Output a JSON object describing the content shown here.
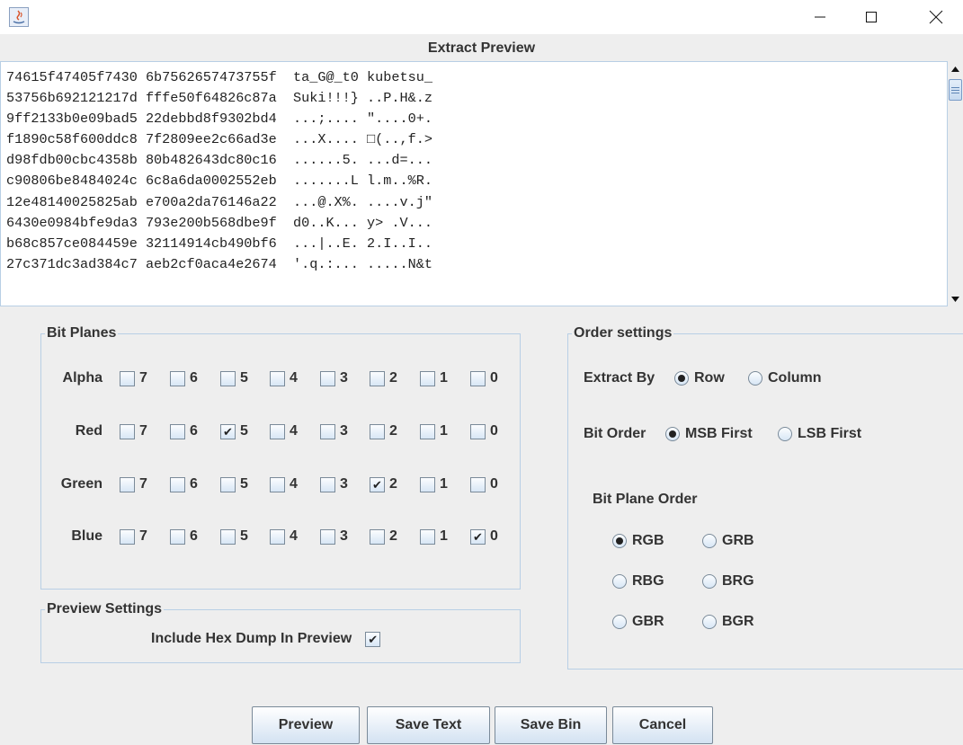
{
  "window": {
    "title": "",
    "minimize_glyph": "—",
    "maximize_glyph": "☐",
    "close_glyph": "✕"
  },
  "preview": {
    "title": "Extract Preview",
    "lines": [
      "74615f47405f7430 6b7562657473755f  ta_G@_t0 kubetsu_",
      "53756b692121217d fffe50f64826c87a  Suki!!!} ..P.H&.z",
      "9ff2133b0e09bad5 22debbd8f9302bd4  ...;.... \"....0+.",
      "f1890c58f600ddc8 7f2809ee2c66ad3e  ...X.... □(..,f.>",
      "d98fdb00cbc4358b 80b482643dc80c16  ......5. ...d=...",
      "c90806be8484024c 6c8a6da0002552eb  .......L l.m..%R.",
      "12e48140025825ab e700a2da76146a22  ...@.X%. ....v.j\"",
      "6430e0984bfe9da3 793e200b568dbe9f  d0..K... y> .V...",
      "b68c857ce084459e 32114914cb490bf6  ...|..E. 2.I..I..",
      "27c371dc3ad384c7 aeb2cf0aca4e2674  '.q.:... .....N&t"
    ]
  },
  "bit_planes": {
    "legend": "Bit Planes",
    "bits": [
      "7",
      "6",
      "5",
      "4",
      "3",
      "2",
      "1",
      "0"
    ],
    "rows": [
      {
        "label": "Alpha",
        "checked": []
      },
      {
        "label": "Red",
        "checked": [
          "5"
        ]
      },
      {
        "label": "Green",
        "checked": [
          "2"
        ]
      },
      {
        "label": "Blue",
        "checked": [
          "0"
        ]
      }
    ]
  },
  "preview_settings": {
    "legend": "Preview Settings",
    "hex_dump_label": "Include Hex Dump In Preview",
    "hex_dump_checked": true
  },
  "order_settings": {
    "legend": "Order settings",
    "extract_by_label": "Extract By",
    "extract_by_options": [
      "Row",
      "Column"
    ],
    "extract_by_selected": "Row",
    "bit_order_label": "Bit Order",
    "bit_order_options": [
      "MSB First",
      "LSB First"
    ],
    "bit_order_selected": "MSB First",
    "bit_plane_order_label": "Bit Plane Order",
    "bit_plane_order_options": [
      "RGB",
      "GRB",
      "RBG",
      "BRG",
      "GBR",
      "BGR"
    ],
    "bit_plane_order_selected": "RGB"
  },
  "buttons": {
    "preview": "Preview",
    "save_text": "Save Text",
    "save_bin": "Save Bin",
    "cancel": "Cancel"
  },
  "check_glyph": "✔"
}
